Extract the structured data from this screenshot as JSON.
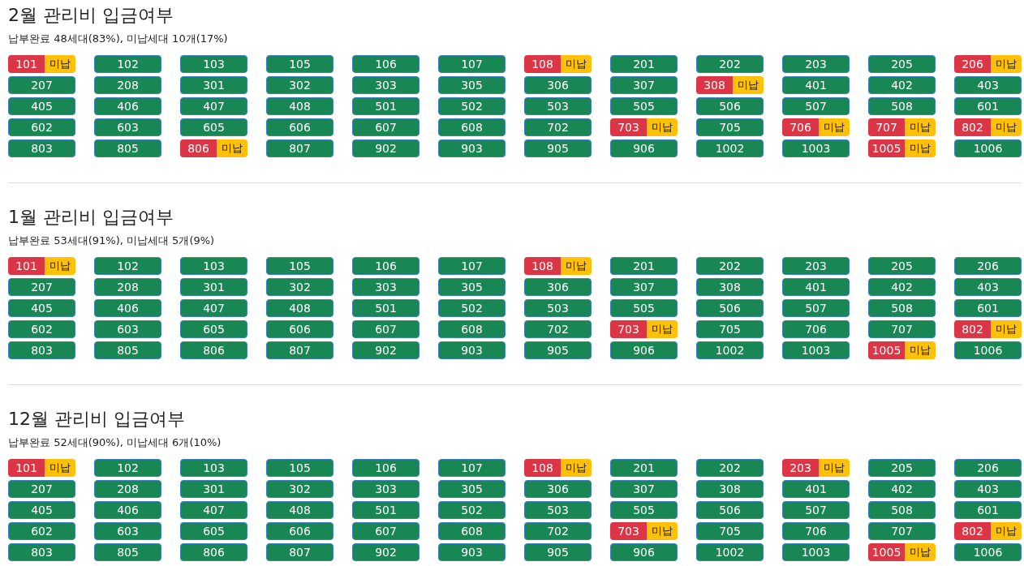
{
  "sections": [
    {
      "title": "2월 관리비 입금여부",
      "summary": "납부완료 48세대(83%), 미납세대 10개(17%)",
      "units": [
        {
          "unit": "101",
          "paid": false,
          "badge": "미납"
        },
        {
          "unit": "102",
          "paid": true
        },
        {
          "unit": "103",
          "paid": true
        },
        {
          "unit": "105",
          "paid": true
        },
        {
          "unit": "106",
          "paid": true
        },
        {
          "unit": "107",
          "paid": true
        },
        {
          "unit": "108",
          "paid": false,
          "badge": "미납"
        },
        {
          "unit": "201",
          "paid": true
        },
        {
          "unit": "202",
          "paid": true
        },
        {
          "unit": "203",
          "paid": true
        },
        {
          "unit": "205",
          "paid": true
        },
        {
          "unit": "206",
          "paid": false,
          "badge": "미납"
        },
        {
          "unit": "207",
          "paid": true
        },
        {
          "unit": "208",
          "paid": true
        },
        {
          "unit": "301",
          "paid": true
        },
        {
          "unit": "302",
          "paid": true
        },
        {
          "unit": "303",
          "paid": true
        },
        {
          "unit": "305",
          "paid": true
        },
        {
          "unit": "306",
          "paid": true
        },
        {
          "unit": "307",
          "paid": true
        },
        {
          "unit": "308",
          "paid": false,
          "badge": "미납"
        },
        {
          "unit": "401",
          "paid": true
        },
        {
          "unit": "402",
          "paid": true
        },
        {
          "unit": "403",
          "paid": true
        },
        {
          "unit": "405",
          "paid": true
        },
        {
          "unit": "406",
          "paid": true
        },
        {
          "unit": "407",
          "paid": true
        },
        {
          "unit": "408",
          "paid": true
        },
        {
          "unit": "501",
          "paid": true
        },
        {
          "unit": "502",
          "paid": true
        },
        {
          "unit": "503",
          "paid": true
        },
        {
          "unit": "505",
          "paid": true
        },
        {
          "unit": "506",
          "paid": true
        },
        {
          "unit": "507",
          "paid": true
        },
        {
          "unit": "508",
          "paid": true
        },
        {
          "unit": "601",
          "paid": true
        },
        {
          "unit": "602",
          "paid": true
        },
        {
          "unit": "603",
          "paid": true
        },
        {
          "unit": "605",
          "paid": true
        },
        {
          "unit": "606",
          "paid": true
        },
        {
          "unit": "607",
          "paid": true
        },
        {
          "unit": "608",
          "paid": true
        },
        {
          "unit": "702",
          "paid": true
        },
        {
          "unit": "703",
          "paid": false,
          "badge": "미납"
        },
        {
          "unit": "705",
          "paid": true
        },
        {
          "unit": "706",
          "paid": false,
          "badge": "미납"
        },
        {
          "unit": "707",
          "paid": false,
          "badge": "미납"
        },
        {
          "unit": "802",
          "paid": false,
          "badge": "미납"
        },
        {
          "unit": "803",
          "paid": true
        },
        {
          "unit": "805",
          "paid": true
        },
        {
          "unit": "806",
          "paid": false,
          "badge": "미납"
        },
        {
          "unit": "807",
          "paid": true
        },
        {
          "unit": "902",
          "paid": true
        },
        {
          "unit": "903",
          "paid": true
        },
        {
          "unit": "905",
          "paid": true
        },
        {
          "unit": "906",
          "paid": true
        },
        {
          "unit": "1002",
          "paid": true
        },
        {
          "unit": "1003",
          "paid": true
        },
        {
          "unit": "1005",
          "paid": false,
          "badge": "미납"
        },
        {
          "unit": "1006",
          "paid": true
        }
      ]
    },
    {
      "title": "1월 관리비 입금여부",
      "summary": "납부완료 53세대(91%), 미납세대 5개(9%)",
      "units": [
        {
          "unit": "101",
          "paid": false,
          "badge": "미납"
        },
        {
          "unit": "102",
          "paid": true
        },
        {
          "unit": "103",
          "paid": true
        },
        {
          "unit": "105",
          "paid": true
        },
        {
          "unit": "106",
          "paid": true
        },
        {
          "unit": "107",
          "paid": true
        },
        {
          "unit": "108",
          "paid": false,
          "badge": "미납"
        },
        {
          "unit": "201",
          "paid": true
        },
        {
          "unit": "202",
          "paid": true
        },
        {
          "unit": "203",
          "paid": true
        },
        {
          "unit": "205",
          "paid": true
        },
        {
          "unit": "206",
          "paid": true
        },
        {
          "unit": "207",
          "paid": true
        },
        {
          "unit": "208",
          "paid": true
        },
        {
          "unit": "301",
          "paid": true
        },
        {
          "unit": "302",
          "paid": true
        },
        {
          "unit": "303",
          "paid": true
        },
        {
          "unit": "305",
          "paid": true
        },
        {
          "unit": "306",
          "paid": true
        },
        {
          "unit": "307",
          "paid": true
        },
        {
          "unit": "308",
          "paid": true
        },
        {
          "unit": "401",
          "paid": true
        },
        {
          "unit": "402",
          "paid": true
        },
        {
          "unit": "403",
          "paid": true
        },
        {
          "unit": "405",
          "paid": true
        },
        {
          "unit": "406",
          "paid": true
        },
        {
          "unit": "407",
          "paid": true
        },
        {
          "unit": "408",
          "paid": true
        },
        {
          "unit": "501",
          "paid": true
        },
        {
          "unit": "502",
          "paid": true
        },
        {
          "unit": "503",
          "paid": true
        },
        {
          "unit": "505",
          "paid": true
        },
        {
          "unit": "506",
          "paid": true
        },
        {
          "unit": "507",
          "paid": true
        },
        {
          "unit": "508",
          "paid": true
        },
        {
          "unit": "601",
          "paid": true
        },
        {
          "unit": "602",
          "paid": true
        },
        {
          "unit": "603",
          "paid": true
        },
        {
          "unit": "605",
          "paid": true
        },
        {
          "unit": "606",
          "paid": true
        },
        {
          "unit": "607",
          "paid": true
        },
        {
          "unit": "608",
          "paid": true
        },
        {
          "unit": "702",
          "paid": true
        },
        {
          "unit": "703",
          "paid": false,
          "badge": "미납"
        },
        {
          "unit": "705",
          "paid": true
        },
        {
          "unit": "706",
          "paid": true
        },
        {
          "unit": "707",
          "paid": true
        },
        {
          "unit": "802",
          "paid": false,
          "badge": "미납"
        },
        {
          "unit": "803",
          "paid": true
        },
        {
          "unit": "805",
          "paid": true
        },
        {
          "unit": "806",
          "paid": true
        },
        {
          "unit": "807",
          "paid": true
        },
        {
          "unit": "902",
          "paid": true
        },
        {
          "unit": "903",
          "paid": true
        },
        {
          "unit": "905",
          "paid": true
        },
        {
          "unit": "906",
          "paid": true
        },
        {
          "unit": "1002",
          "paid": true
        },
        {
          "unit": "1003",
          "paid": true
        },
        {
          "unit": "1005",
          "paid": false,
          "badge": "미납"
        },
        {
          "unit": "1006",
          "paid": true
        }
      ]
    },
    {
      "title": "12월 관리비 입금여부",
      "summary": "납부완료 52세대(90%), 미납세대 6개(10%)",
      "units": [
        {
          "unit": "101",
          "paid": false,
          "badge": "미납"
        },
        {
          "unit": "102",
          "paid": true
        },
        {
          "unit": "103",
          "paid": true
        },
        {
          "unit": "105",
          "paid": true
        },
        {
          "unit": "106",
          "paid": true
        },
        {
          "unit": "107",
          "paid": true
        },
        {
          "unit": "108",
          "paid": false,
          "badge": "미납"
        },
        {
          "unit": "201",
          "paid": true
        },
        {
          "unit": "202",
          "paid": true
        },
        {
          "unit": "203",
          "paid": false,
          "badge": "미납"
        },
        {
          "unit": "205",
          "paid": true
        },
        {
          "unit": "206",
          "paid": true
        },
        {
          "unit": "207",
          "paid": true
        },
        {
          "unit": "208",
          "paid": true
        },
        {
          "unit": "301",
          "paid": true
        },
        {
          "unit": "302",
          "paid": true
        },
        {
          "unit": "303",
          "paid": true
        },
        {
          "unit": "305",
          "paid": true
        },
        {
          "unit": "306",
          "paid": true
        },
        {
          "unit": "307",
          "paid": true
        },
        {
          "unit": "308",
          "paid": true
        },
        {
          "unit": "401",
          "paid": true
        },
        {
          "unit": "402",
          "paid": true
        },
        {
          "unit": "403",
          "paid": true
        },
        {
          "unit": "405",
          "paid": true
        },
        {
          "unit": "406",
          "paid": true
        },
        {
          "unit": "407",
          "paid": true
        },
        {
          "unit": "408",
          "paid": true
        },
        {
          "unit": "501",
          "paid": true
        },
        {
          "unit": "502",
          "paid": true
        },
        {
          "unit": "503",
          "paid": true
        },
        {
          "unit": "505",
          "paid": true
        },
        {
          "unit": "506",
          "paid": true
        },
        {
          "unit": "507",
          "paid": true
        },
        {
          "unit": "508",
          "paid": true
        },
        {
          "unit": "601",
          "paid": true
        },
        {
          "unit": "602",
          "paid": true
        },
        {
          "unit": "603",
          "paid": true
        },
        {
          "unit": "605",
          "paid": true
        },
        {
          "unit": "606",
          "paid": true
        },
        {
          "unit": "607",
          "paid": true
        },
        {
          "unit": "608",
          "paid": true
        },
        {
          "unit": "702",
          "paid": true
        },
        {
          "unit": "703",
          "paid": false,
          "badge": "미납"
        },
        {
          "unit": "705",
          "paid": true
        },
        {
          "unit": "706",
          "paid": true
        },
        {
          "unit": "707",
          "paid": true
        },
        {
          "unit": "802",
          "paid": false,
          "badge": "미납"
        },
        {
          "unit": "803",
          "paid": true
        },
        {
          "unit": "805",
          "paid": true
        },
        {
          "unit": "806",
          "paid": true
        },
        {
          "unit": "807",
          "paid": true
        },
        {
          "unit": "902",
          "paid": true
        },
        {
          "unit": "903",
          "paid": true
        },
        {
          "unit": "905",
          "paid": true
        },
        {
          "unit": "906",
          "paid": true
        },
        {
          "unit": "1002",
          "paid": true
        },
        {
          "unit": "1003",
          "paid": true
        },
        {
          "unit": "1005",
          "paid": false,
          "badge": "미납"
        },
        {
          "unit": "1006",
          "paid": true
        }
      ]
    }
  ]
}
